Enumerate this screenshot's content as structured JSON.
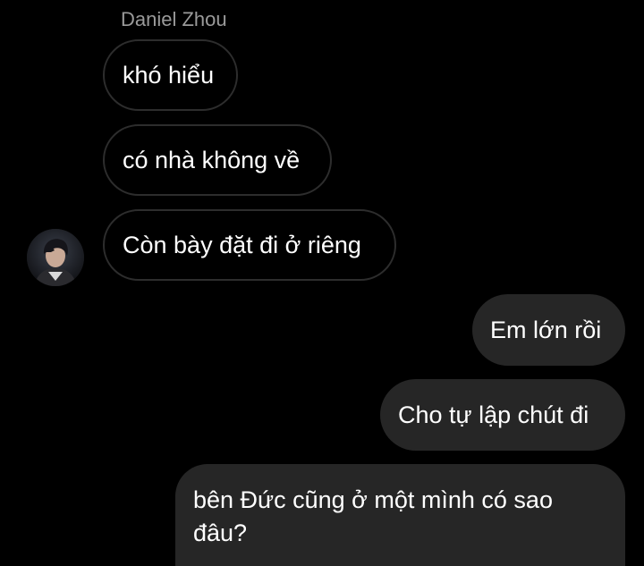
{
  "thread": {
    "incoming_sender": "Daniel Zhou",
    "messages": [
      {
        "direction": "in",
        "text": "khó hiểu"
      },
      {
        "direction": "in",
        "text": "có nhà không về"
      },
      {
        "direction": "in",
        "text": "Còn bày đặt đi ở riêng"
      },
      {
        "direction": "out",
        "text": "Em lớn rồi"
      },
      {
        "direction": "out",
        "text": "Cho tự lập chút đi"
      },
      {
        "direction": "out",
        "text": "bên Đức cũng ở một mình có sao đâu?"
      }
    ]
  },
  "avatar": {
    "icon": "profile-photo",
    "alt": "Daniel Zhou avatar"
  },
  "colors": {
    "background": "#000000",
    "incoming_border": "#2d2d2d",
    "outgoing_bubble": "#262626",
    "sender_name": "#9a9a9a",
    "text": "#ffffff"
  }
}
